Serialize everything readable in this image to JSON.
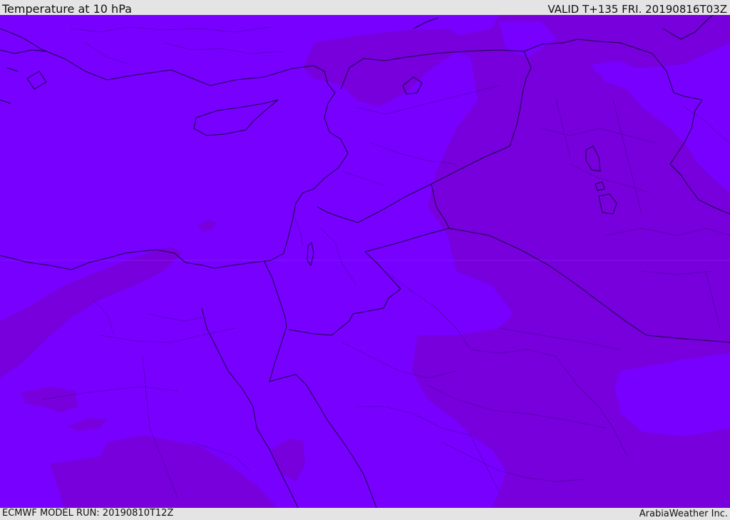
{
  "header": {
    "title": "Temperature at 10 hPa",
    "valid": "VALID T+135 FRI. 20190816T03Z"
  },
  "footer": {
    "model_run": "ECMWF MODEL RUN: 20190810T12Z",
    "credit": "ArabiaWeather Inc."
  },
  "map": {
    "field": "temperature",
    "level": "10 hPa",
    "colors": {
      "field_light": "#7800ff",
      "field_dark": "#7700dd",
      "coastline": "#1a0040",
      "border": "#1a0040"
    }
  }
}
